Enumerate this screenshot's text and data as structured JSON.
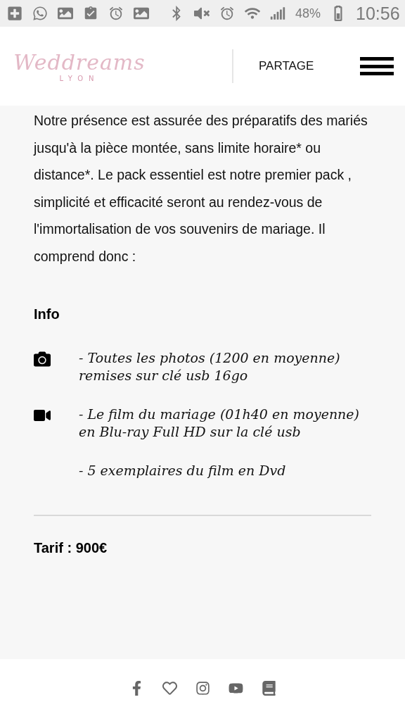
{
  "status_bar": {
    "battery": "48%",
    "time": "10:56"
  },
  "header": {
    "logo": {
      "name": "Weddreams",
      "city": "LYON"
    },
    "share_link": "PARTAGE"
  },
  "intro": "Notre présence est assurée des préparatifs des mariés jusqu'à la pièce montée, sans limite horaire* ou distance*. Le pack essentiel est notre premier pack , simplicité et efficacité seront au rendez-vous de l'immortalisation de vos souvenirs de mariage. Il comprend donc :",
  "info": {
    "title": "Info",
    "items": [
      {
        "kind": "camera",
        "text": "- Toutes les photos (1200 en moyenne) remises sur clé usb 16go"
      },
      {
        "kind": "video",
        "text": "- Le film du mariage (01h40 en moyenne) en Blu-ray Full HD sur la clé usb"
      },
      {
        "kind": "none",
        "text": "- 5 exemplaires du film en Dvd"
      }
    ]
  },
  "price": "Tarif : 900€",
  "footer": {
    "icons": [
      {
        "kind": "facebook"
      },
      {
        "kind": "heart"
      },
      {
        "kind": "instagram"
      },
      {
        "kind": "youtube"
      },
      {
        "kind": "book"
      }
    ]
  }
}
